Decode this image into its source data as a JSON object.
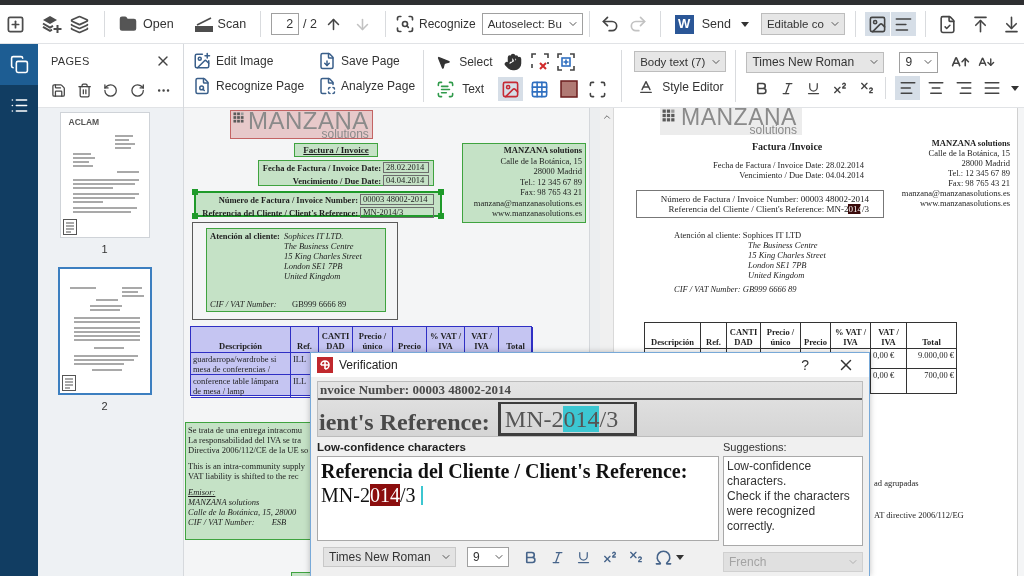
{
  "app_toolbar": {
    "open_label": "Open",
    "scan_label": "Scan",
    "page_field": {
      "value": "2"
    },
    "page_total": "/ 2",
    "page_arrows": [
      {
        "disabled": false
      },
      {
        "disabled": true
      }
    ],
    "recognize_label": "Recognize",
    "autoselect": {
      "value": "Autoselect: Bu"
    },
    "history": [
      {
        "disabled": false
      },
      {
        "disabled": true
      }
    ],
    "send_app_letter": "W",
    "send_label": "Send",
    "output_mode": {
      "value": "Editable co"
    },
    "view_toggles": [
      {
        "selected": true
      },
      {
        "selected": true
      }
    ]
  },
  "sidebar_tabs": [
    {
      "selected": true
    },
    {
      "selected": false
    }
  ],
  "pages_panel": {
    "title": "PAGES",
    "pages": [
      {
        "number": "1",
        "selected": false,
        "thumbnail_logo": "ACLAM"
      },
      {
        "number": "2",
        "selected": true
      }
    ]
  },
  "image_toolbar": {
    "actions": [
      {
        "label": "Edit Image"
      },
      {
        "label": "Save Page"
      },
      {
        "label": "Recognize Page"
      },
      {
        "label": "Analyze Page"
      }
    ],
    "select_label": "Select",
    "area_tools": [
      {
        "label": "Text",
        "selected": false
      },
      {
        "selected": true
      },
      {
        "selected": false
      },
      {
        "selected": false
      },
      {
        "selected": false
      }
    ]
  },
  "format_toolbar": {
    "style": {
      "value": "Body text (7)"
    },
    "style_editor_label": "Style Editor",
    "font": {
      "value": "Times New Roman"
    },
    "size": {
      "value": "9"
    },
    "alignment": [
      {
        "selected": true
      },
      {
        "selected": false
      },
      {
        "selected": false
      },
      {
        "selected": false
      }
    ]
  },
  "image_page": {
    "zones": [
      {
        "kind": "picture",
        "selected": false,
        "logo": {
          "word": "MANZANA",
          "sub": "solutions"
        }
      },
      {
        "kind": "text",
        "selected": false,
        "lines": [
          "Factura / Invoice"
        ]
      },
      {
        "kind": "text",
        "selected": false,
        "rows": [
          {
            "label": "Fecha de Factura / Invoice Date:",
            "value": "28.02.2014"
          },
          {
            "label": "Vencimiento / Due Date:",
            "value": "04.04.2014"
          }
        ]
      },
      {
        "kind": "text",
        "selected": true,
        "rows": [
          {
            "label": "Número de Factura / Invoice Number:",
            "value": "00003 48002-2014"
          },
          {
            "label": "Referencia del Cliente / Client's Reference:",
            "value": "MN-2014/3"
          }
        ]
      },
      {
        "kind": "text",
        "selected": false,
        "lines": [
          "MANZANA solutions",
          "Calle de la Botánica, 15",
          "28000 Madrid",
          "Tel.: 12 345 67 89",
          "Fax: 98 765 43 21",
          "manzana@manzanasolutions.es",
          "www.manzanasolutions.es"
        ]
      },
      {
        "kind": "region",
        "selected": false
      },
      {
        "kind": "text",
        "selected": false,
        "heading": "Atención al cliente:",
        "lines": [
          "Sophices IT LTD.",
          "The Business Centre",
          "15 King Charles Street",
          "London SE1 7PB",
          "United Kingdom"
        ],
        "footer": {
          "label": "CIF / VAT Number:",
          "value": "GB999 6666 89"
        }
      },
      {
        "kind": "table",
        "selected": false,
        "columns": [
          "Descripción",
          "Ref.",
          "CANTI DAD",
          "Precio / único",
          "Precio",
          "% VAT / IVA",
          "VAT / IVA",
          "Total"
        ],
        "rows": [
          {
            "description": "guardarropa/wardrobe si mesa de conferencias /",
            "ref": "ILL"
          },
          {
            "description": "conference table lámpara de mesa / lamp",
            "ref": "ILL"
          }
        ]
      },
      {
        "kind": "text",
        "selected": false,
        "paragraphs": [
          [
            "Se trata de una entrega intracomu",
            "La responsabilidad del IVA se tra",
            "Directiva 2006/112/CE de la UE so"
          ],
          [
            "This is an intra-community supply",
            "VAT liability is shifted to the rec"
          ],
          [
            "Emisor:",
            "MANZANA solutions",
            "Calle de la Botánica, 15, 28000",
            "CIF / VAT Number:        ESB"
          ]
        ]
      },
      {
        "kind": "text",
        "selected": false
      }
    ]
  },
  "text_page": {
    "logo": {
      "word": "MANZANA",
      "sub": "solutions"
    },
    "title": "Factura /Invoice",
    "date_lines": [
      "Fecha de Factura / Invoice Date: 28.02.2014",
      "Vencimiento / Due Date: 04.04.2014"
    ],
    "number_lines": [
      {
        "segments": [
          {
            "text": "Número de Factura / Invoice Number: 00003 48002-2014",
            "flagged": false
          }
        ]
      },
      {
        "segments": [
          {
            "text": "Referencia del Cliente / Client's Reference: MN-2",
            "flagged": false
          },
          {
            "text": "014",
            "flagged": true
          },
          {
            "text": "/3",
            "flagged": false
          }
        ]
      }
    ],
    "company_lines": [
      "MANZANA solutions",
      "Calle de la Botánica, 15",
      "28000 Madrid",
      "Tel.: 12 345 67 89",
      "Fax: 98 765 43 21",
      "manzana@manzanasolutions.es",
      "www.manzanasolutions.es"
    ],
    "client_lines": [
      "Atención al cliente: Sophices IT LTD",
      "The Business Centre",
      "15 King Charles Street",
      "London SE1 7PB",
      "United Kingdom"
    ],
    "vat_line": "CIF / VAT Number: GB999 6666 89",
    "table": {
      "columns": [
        "Descripción",
        "Ref.",
        "CANTI DAD",
        "Precio / único",
        "Precio",
        "% VAT / IVA",
        "VAT / IVA",
        "Total"
      ],
      "rows": [
        {
          "vat": "0,00 €",
          "total": "9.000,00 €"
        },
        {
          "vat": "0,00 €",
          "total": "700,00 €"
        }
      ]
    },
    "fragments": [
      "ad agrupadas",
      "AT directive 2006/112/EG"
    ]
  },
  "verification": {
    "title": "Verification",
    "help_label": "?",
    "preview": {
      "top_line": "nvoice Number: 00003 48002-2014",
      "label": "ient's Reference:",
      "value_segments": [
        {
          "text": "MN-2",
          "highlighted": false
        },
        {
          "text": "014",
          "highlighted": true
        },
        {
          "text": "/3",
          "highlighted": false
        }
      ]
    },
    "editor_label": "Low-confidence characters",
    "editor": {
      "heading": "Referencia del Cliente / Client's Reference:",
      "value_segments": [
        {
          "text": "MN-2",
          "flagged": false
        },
        {
          "text": "014",
          "flagged": true
        },
        {
          "text": "/3",
          "flagged": false
        }
      ]
    },
    "editor_font": {
      "value": "Times New Roman"
    },
    "editor_size": {
      "value": "9"
    },
    "suggestions_label": "Suggestions:",
    "suggestions": [
      "Low-confidence characters.",
      "Check if the characters were recognized correctly."
    ],
    "language": {
      "value": "French",
      "disabled": true
    }
  }
}
